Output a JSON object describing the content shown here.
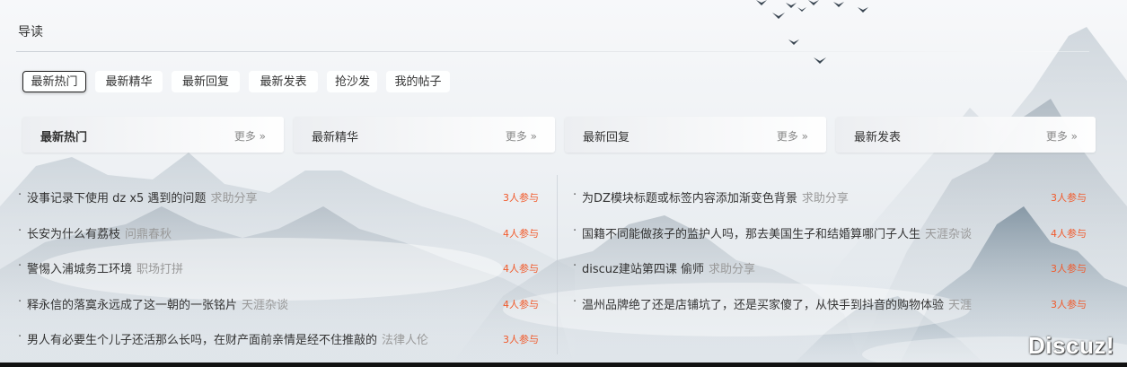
{
  "section": {
    "title": "导读"
  },
  "tabs": [
    {
      "label": "最新热门",
      "active": true
    },
    {
      "label": "最新精华",
      "active": false
    },
    {
      "label": "最新回复",
      "active": false
    },
    {
      "label": "最新发表",
      "active": false
    },
    {
      "label": "抢沙发",
      "active": false
    },
    {
      "label": "我的帖子",
      "active": false
    }
  ],
  "panels": [
    {
      "title": "最新热门",
      "more": "更多 »"
    },
    {
      "title": "最新精华",
      "more": "更多 »"
    },
    {
      "title": "最新回复",
      "more": "更多 »"
    },
    {
      "title": "最新发表",
      "more": "更多 »"
    }
  ],
  "threads_left": [
    {
      "title": "没事记录下使用 dz x5 遇到的问题",
      "category": "求助分享",
      "count": "3人参与"
    },
    {
      "title": "长安为什么有荔枝",
      "category": "问鼎春秋",
      "count": "4人参与"
    },
    {
      "title": "警惕入浦城务工环境",
      "category": "职场打拼",
      "count": "4人参与"
    },
    {
      "title": "释永信的落寞永远成了这一朝的一张铭片",
      "category": "天涯杂谈",
      "count": "4人参与"
    },
    {
      "title": "男人有必要生个儿子还活那么长吗，在财产面前亲情是经不住推敲的",
      "category": "法律人伦",
      "count": "3人参与"
    }
  ],
  "threads_right": [
    {
      "title": "为DZ模块标题或标签内容添加渐变色背景",
      "category": "求助分享",
      "count": "3人参与"
    },
    {
      "title": "国籍不同能做孩子的监护人吗，那去美国生子和结婚算哪门子人生",
      "category": "天涯杂谈",
      "count": "4人参与"
    },
    {
      "title": "discuz建站第四课 偷师",
      "category": "求助分享",
      "count": "3人参与"
    },
    {
      "title": "温州品牌绝了还是店铺坑了，还是买家傻了，从快手到抖音的购物体验",
      "category": "天涯",
      "count": "3人参与"
    }
  ],
  "watermark": "Discuz!",
  "colors": {
    "accent": "#f1592a",
    "muted": "#999999",
    "text": "#333333"
  }
}
